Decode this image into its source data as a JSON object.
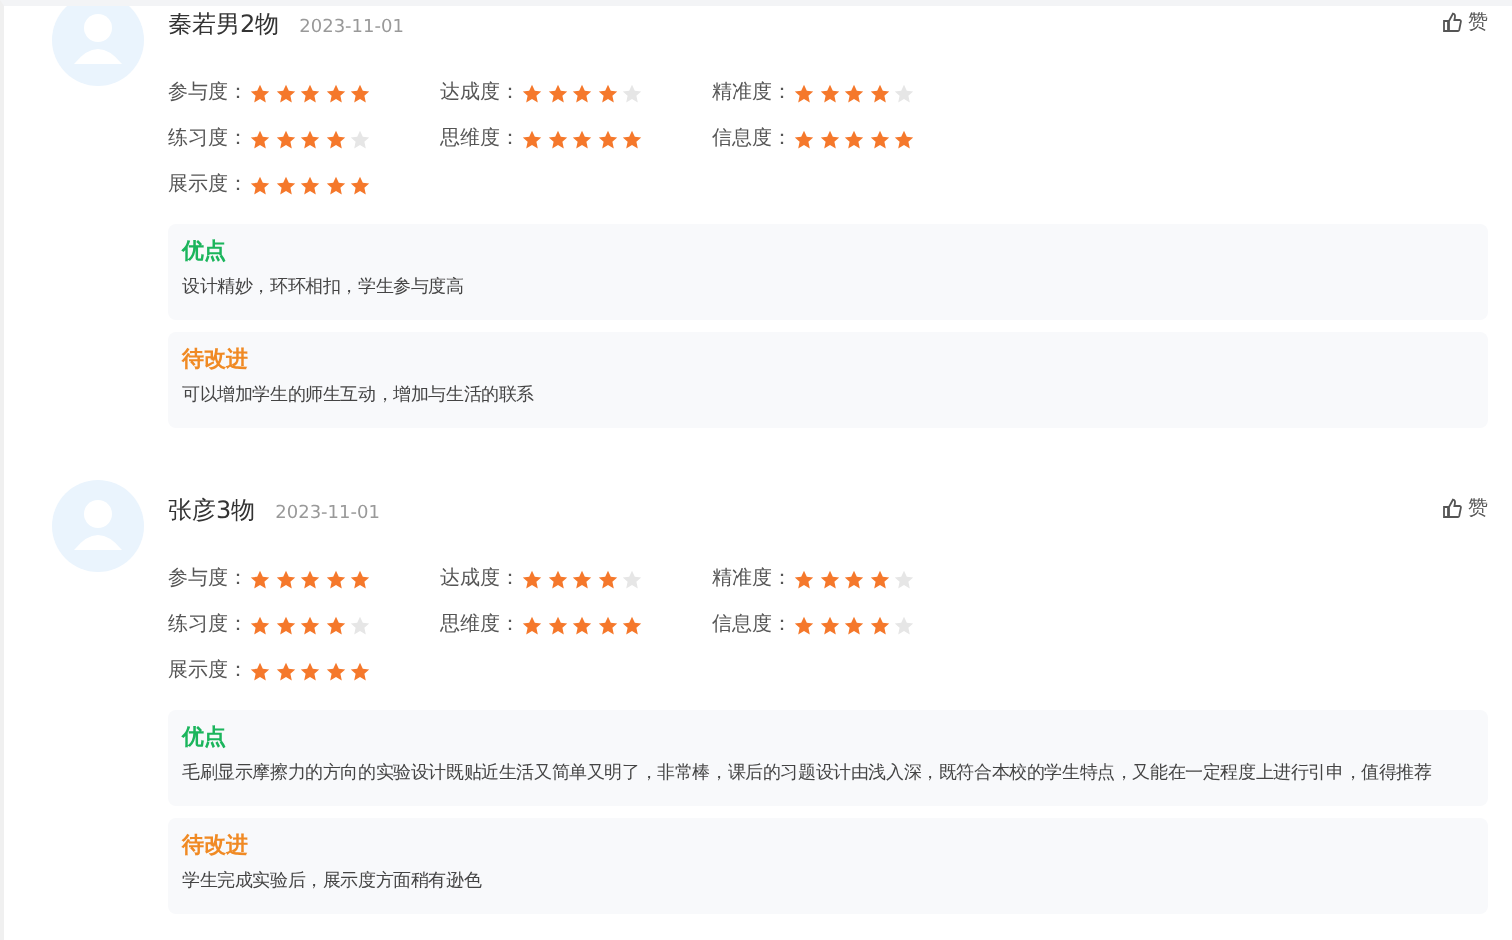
{
  "reviews": [
    {
      "name": "秦若男2物",
      "date": "2023-11-01",
      "like": "赞",
      "ratings": [
        {
          "label": "参与度：",
          "stars": 5
        },
        {
          "label": "达成度：",
          "stars": 4
        },
        {
          "label": "精准度：",
          "stars": 4
        },
        {
          "label": "练习度：",
          "stars": 4
        },
        {
          "label": "思维度：",
          "stars": 5
        },
        {
          "label": "信息度：",
          "stars": 5
        },
        {
          "label": "展示度：",
          "stars": 5
        }
      ],
      "notes": [
        {
          "kind": "good",
          "title": "优点",
          "text": "设计精妙，环环相扣，学生参与度高"
        },
        {
          "kind": "improve",
          "title": "待改进",
          "text": "可以增加学生的师生互动，增加与生活的联系"
        }
      ]
    },
    {
      "name": "张彦3物",
      "date": "2023-11-01",
      "like": "赞",
      "ratings": [
        {
          "label": "参与度：",
          "stars": 5
        },
        {
          "label": "达成度：",
          "stars": 4
        },
        {
          "label": "精准度：",
          "stars": 4
        },
        {
          "label": "练习度：",
          "stars": 4
        },
        {
          "label": "思维度：",
          "stars": 5
        },
        {
          "label": "信息度：",
          "stars": 4
        },
        {
          "label": "展示度：",
          "stars": 5
        }
      ],
      "notes": [
        {
          "kind": "good",
          "title": "优点",
          "text": "毛刷显示摩擦力的方向的实验设计既贴近生活又简单又明了，非常棒，课后的习题设计由浅入深，既符合本校的学生特点，又能在一定程度上进行引申，值得推荐"
        },
        {
          "kind": "improve",
          "title": "待改进",
          "text": "学生完成实验后，展示度方面稍有逊色"
        }
      ]
    }
  ]
}
